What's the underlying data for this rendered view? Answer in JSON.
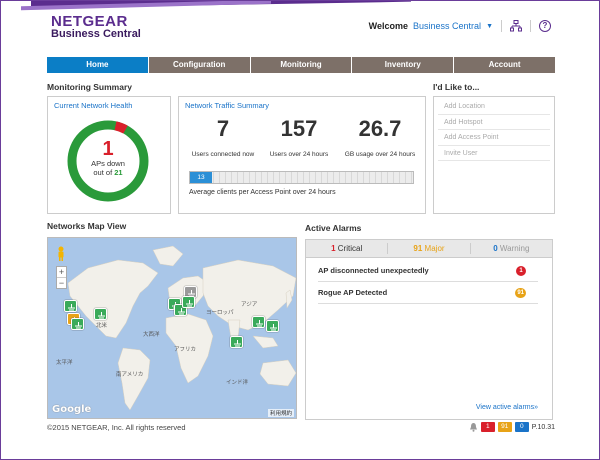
{
  "brand": {
    "name": "NETGEAR",
    "product": "Business Central"
  },
  "header": {
    "welcome_label": "Welcome",
    "user": "Business Central",
    "icons": [
      "caret-down-icon",
      "network-icon",
      "help-icon"
    ]
  },
  "nav": {
    "tabs": [
      "Home",
      "Configuration",
      "Monitoring",
      "Inventory",
      "Account"
    ],
    "active": "Home"
  },
  "monitoring_summary": {
    "title": "Monitoring Summary",
    "network_health": {
      "title": "Current Network Health",
      "down": "1",
      "down_label": "APs down",
      "of_label": "out of",
      "total": "21",
      "ratio_down": 0.0476
    },
    "traffic": {
      "title": "Network Traffic Summary",
      "stats": [
        {
          "value": "7",
          "label": "Users connected now"
        },
        {
          "value": "157",
          "label": "Users over 24 hours"
        },
        {
          "value": "26.7",
          "label": "GB usage over 24 hours"
        }
      ],
      "avg_clients": "13",
      "avg_clients_fraction": 0.1,
      "avg_caption": "Average clients per Access Point over 24 hours"
    }
  },
  "ilike": {
    "title": "I'd Like to...",
    "items": [
      "Add Location",
      "Add Hotspot",
      "Add Access Point",
      "Invite User"
    ]
  },
  "map": {
    "title": "Networks Map View",
    "labels": {
      "europe": "ヨーロッパ",
      "asia": "アジア",
      "africa": "アフリカ",
      "north_america": "北米",
      "south_america": "南アメリカ",
      "indian_ocean": "インド洋",
      "pacific": "太平洋",
      "atlantic": "大西洋"
    },
    "zoom_in": "+",
    "zoom_out": "−",
    "google": "Google",
    "credit": "利用規約",
    "colors": {
      "ok": "#3aaa5a",
      "warn": "#e8a317",
      "down": "#9a9a9a",
      "land": "#f2f0ea",
      "water": "#a9c6e8"
    }
  },
  "alarms": {
    "title": "Active Alarms",
    "counts": [
      {
        "num": "1",
        "label": "Critical"
      },
      {
        "num": "91",
        "label": "Major"
      },
      {
        "num": "0",
        "label": "Warning"
      }
    ],
    "rows": [
      {
        "text": "AP disconnected unexpectedly",
        "count": "1",
        "color": "#d9202b"
      },
      {
        "text": "Rogue AP Detected",
        "count": "91",
        "color": "#e8a317"
      }
    ],
    "view_link": "View active alarms»"
  },
  "footer": {
    "copyright": "©2015 NETGEAR, Inc. All rights reserved"
  },
  "status_bar": {
    "critical": "1",
    "major": "91",
    "warning": "0",
    "version": "P.10.31",
    "colors": {
      "critical": "#d9202b",
      "major": "#e8a317",
      "warning": "#1a73c8"
    }
  }
}
